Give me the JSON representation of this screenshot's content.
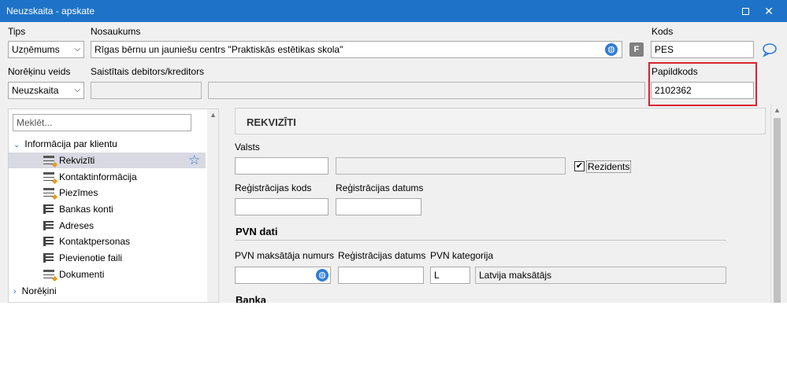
{
  "window": {
    "title": "Neuzskaita - apskate"
  },
  "header": {
    "tips_label": "Tips",
    "tips_value": "Uzņēmums",
    "nosaukums_label": "Nosaukums",
    "nosaukums_value": "Rīgas bērnu un jauniešu centrs \"Praktiskās estētikas skola\"",
    "f_badge": "F",
    "kods_label": "Kods",
    "kods_value": "PES",
    "noreķinu_veids_label": "Norēķinu veids",
    "noreķinu_veids_value": "Neuzskaita",
    "saistitais_label": "Saistītais debitors/kreditors",
    "papildkods_label": "Papildkods",
    "papildkods_value": "2102362"
  },
  "tree": {
    "search_placeholder": "Meklēt...",
    "groups": [
      {
        "label": "Informācija par klientu"
      },
      {
        "label": "Norēķini"
      }
    ],
    "items": [
      {
        "label": "Rekvizīti"
      },
      {
        "label": "Kontaktinformācija"
      },
      {
        "label": "Piezīmes"
      },
      {
        "label": "Bankas konti"
      },
      {
        "label": "Adreses"
      },
      {
        "label": "Kontaktpersonas"
      },
      {
        "label": "Pievienotie faili"
      },
      {
        "label": "Dokumenti"
      }
    ]
  },
  "form": {
    "section_title": "REKVIZĪTI",
    "valsts_label": "Valsts",
    "rezidents_label": "Rezidents",
    "rezidents_checked": "✔",
    "reg_kods_label": "Reģistrācijas kods",
    "reg_datums_label": "Reģistrācijas datums",
    "pvn_title": "PVN dati",
    "pvn_numurs_label": "PVN maksātāja numurs",
    "pvn_reg_datums_label": "Reģistrācijas datums",
    "pvn_kategorija_label": "PVN kategorija",
    "pvn_kategorija_code": "L",
    "pvn_kategorija_name": "Latvija maksātājs",
    "banka_title": "Banka"
  },
  "colors": {
    "titlebar": "#1e73c8",
    "highlight": "#d9232d",
    "selected_row": "#d9d9e3"
  }
}
